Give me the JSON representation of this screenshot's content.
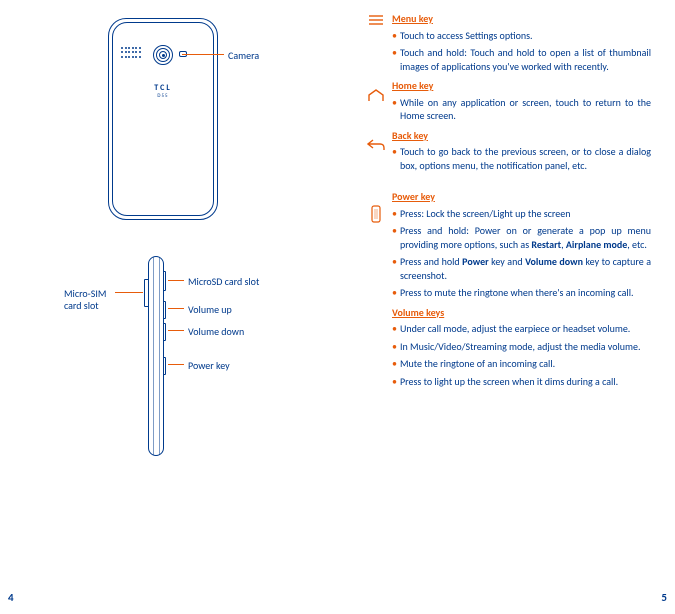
{
  "page_numbers": {
    "left": "4",
    "right": "5"
  },
  "left": {
    "brand": "TCL",
    "model": "D55",
    "labels": {
      "camera": "Camera",
      "microsd": "MicroSD card slot",
      "microsim1": "Micro-SIM",
      "microsim2": "card slot",
      "volup": "Volume up",
      "voldown": "Volume down",
      "powerkey": "Power key"
    }
  },
  "right": {
    "menu": {
      "title": "Menu key",
      "b1": "Touch to access Settings options.",
      "b2": "Touch and hold: Touch and hold to open a list of thumbnail images of applications you've worked with recently."
    },
    "home": {
      "title": "Home key",
      "b1": "While on any application or screen, touch to return to the Home screen."
    },
    "back": {
      "title": "Back key",
      "b1": "Touch to go back to the previous screen, or to close a dialog box, options menu, the notification panel, etc."
    },
    "power": {
      "title": "Power key",
      "b1": "Press: Lock the screen/Light up the screen",
      "b2a": "Press and hold: Power on or generate a pop up menu providing more options, such as ",
      "b2b": "Restart",
      "b2c": ", ",
      "b2d": "Airplane mode",
      "b2e": ", etc.",
      "b3a": "Press and hold ",
      "b3b": "Power",
      "b3c": " key and ",
      "b3d": "Volume down",
      "b3e": " key to capture a screenshot.",
      "b4": "Press to mute the ringtone when there's an incoming call."
    },
    "volume": {
      "title": "Volume keys",
      "b1": "Under call mode, adjust the earpiece or headset volume.",
      "b2": "In Music/Video/Streaming mode, adjust the media volume.",
      "b3": "Mute the ringtone of an incoming call.",
      "b4": "Press to light up the screen when it dims during a call."
    }
  }
}
